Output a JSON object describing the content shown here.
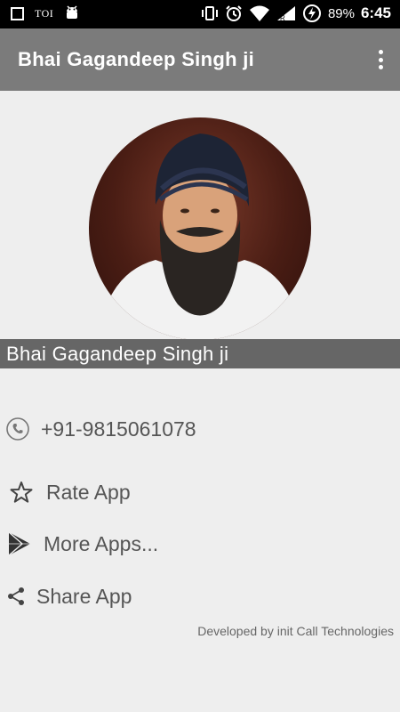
{
  "status_bar": {
    "notification_label": "TOI",
    "battery_percent": "89%",
    "time": "6:45",
    "icons": [
      "square-icon",
      "toi-icon",
      "android-icon",
      "vibrate-icon",
      "alarm-icon",
      "wifi-icon",
      "signal-icon",
      "battery-charging-icon"
    ]
  },
  "app_bar": {
    "title": "Bhai Gagandeep Singh ji",
    "menu_icon": "more-vertical-icon"
  },
  "profile": {
    "name": "Bhai Gagandeep Singh ji",
    "photo": "profile-photo"
  },
  "contact": {
    "phone": "+91-9815061078",
    "icon": "phone-icon"
  },
  "menu": {
    "rate_label": "Rate App",
    "rate_icon": "star-icon",
    "more_label": "More Apps...",
    "more_icon": "play-store-icon",
    "share_label": "Share App",
    "share_icon": "share-icon"
  },
  "footer": {
    "developer_credit": "Developed by init Call Technologies"
  },
  "colors": {
    "status_bar": "#000000",
    "app_bar": "#7b7b7b",
    "name_banner": "#666666",
    "background": "#eeeeee",
    "text": "#555555"
  }
}
